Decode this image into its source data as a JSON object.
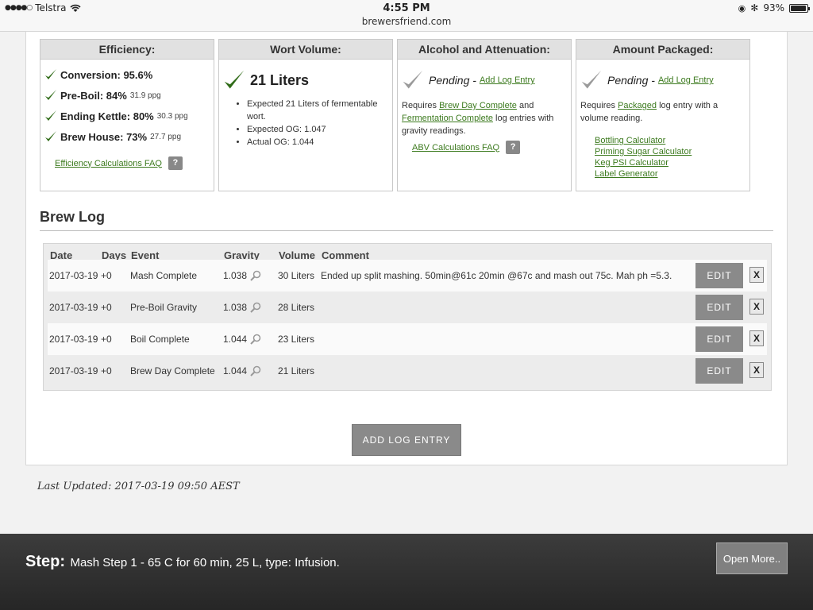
{
  "status": {
    "carrier": "Telstra",
    "time": "4:55 PM",
    "url": "brewersfriend.com",
    "battery": "93%",
    "battery_level": 0.93
  },
  "efficiency": {
    "title": "Efficiency:",
    "rows": [
      {
        "label": "Conversion: 95.6%",
        "ppg": ""
      },
      {
        "label": "Pre-Boil: 84%",
        "ppg": "31.9 ppg"
      },
      {
        "label": "Ending Kettle: 80%",
        "ppg": "30.3 ppg"
      },
      {
        "label": "Brew House: 73%",
        "ppg": "27.7 ppg"
      }
    ],
    "faq_link": "Efficiency Calculations FAQ",
    "help": "?"
  },
  "wort": {
    "title": "Wort Volume:",
    "value": "21 Liters",
    "bullets": [
      "Expected 21 Liters of fermentable wort.",
      "Expected OG: 1.047",
      "Actual OG: 1.044"
    ]
  },
  "alcohol": {
    "title": "Alcohol and Attenuation:",
    "pending": "Pending -",
    "add_link": "Add Log Entry",
    "req_prefix": "Requires",
    "req_link1": "Brew Day Complete",
    "req_and": "and",
    "req_link2": "Fermentation Complete",
    "req_suffix": "log entries with gravity readings.",
    "faq_link": "ABV Calculations FAQ",
    "help": "?"
  },
  "packaged": {
    "title": "Amount Packaged:",
    "pending": "Pending -",
    "add_link": "Add Log Entry",
    "req_prefix": "Requires",
    "req_link": "Packaged",
    "req_suffix": "log entry with a volume reading.",
    "calculators": [
      "Bottling Calculator",
      "Priming Sugar Calculator",
      "Keg PSI Calculator",
      "Label Generator"
    ]
  },
  "brew_log": {
    "title": "Brew Log",
    "columns": [
      "Date",
      "Days",
      "Event",
      "Gravity",
      "Volume",
      "Comment"
    ],
    "rows": [
      {
        "date": "2017-03-19",
        "days": "+0",
        "event": "Mash Complete",
        "gravity": "1.038",
        "volume": "30 Liters",
        "comment": "Ended up split mashing. 50min@61c 20min @67c and mash out 75c. Mah ph =5.3."
      },
      {
        "date": "2017-03-19",
        "days": "+0",
        "event": "Pre-Boil Gravity",
        "gravity": "1.038",
        "volume": "28 Liters",
        "comment": ""
      },
      {
        "date": "2017-03-19",
        "days": "+0",
        "event": "Boil Complete",
        "gravity": "1.044",
        "volume": "23 Liters",
        "comment": ""
      },
      {
        "date": "2017-03-19",
        "days": "+0",
        "event": "Brew Day Complete",
        "gravity": "1.044",
        "volume": "21 Liters",
        "comment": ""
      }
    ],
    "edit_label": "EDIT",
    "delete_label": "X",
    "add_label": "ADD LOG ENTRY"
  },
  "last_updated": "Last Updated: 2017-03-19 09:50 AEST",
  "step": {
    "label": "Step:",
    "text": "Mash Step 1 - 65 C for 60 min, 25 L, type: Infusion.",
    "more": "Open More.."
  },
  "colors": {
    "check": "#2f6b17",
    "pending_check": "#9a9a9a",
    "link": "#3c7a1e",
    "button": "#8a8a8a"
  }
}
